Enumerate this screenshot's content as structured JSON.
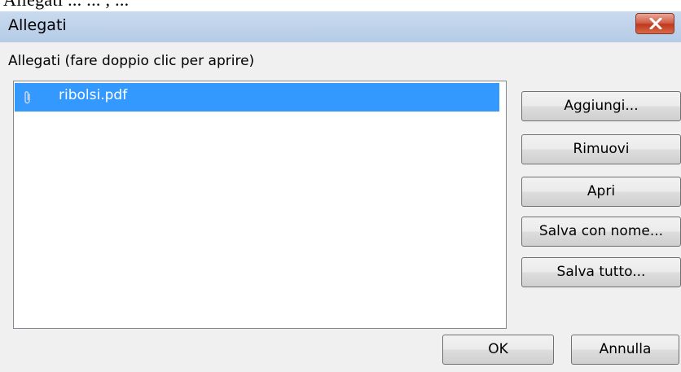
{
  "top_fragment": "Allegati ... ... , ...",
  "dialog": {
    "title": "Allegati",
    "close_icon": "close-x-icon",
    "list_caption": "Allegati (fare doppio clic per aprire)",
    "attachments": [
      {
        "name": "ribolsi.pdf",
        "icon": "paperclip-icon",
        "selected": true
      }
    ]
  },
  "buttons": {
    "add": "Aggiungi...",
    "remove": "Rimuovi",
    "open": "Apri",
    "save_as": "Salva con nome...",
    "save_all": "Salva tutto...",
    "ok": "OK",
    "cancel": "Annulla"
  },
  "colors": {
    "selection": "#3399ff",
    "close_button": "#c0391f",
    "titlebar": "#c9daee"
  }
}
